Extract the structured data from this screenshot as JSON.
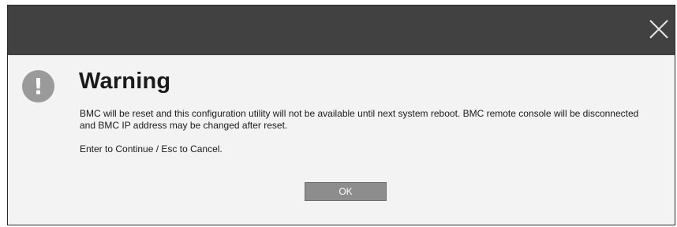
{
  "dialog": {
    "title": "Warning",
    "icon": "warning-exclamation-icon",
    "message": "BMC will be reset and this configuration utility will not be available until next system reboot. BMC remote console will be disconnected and BMC IP address may be changed after reset.",
    "prompt": "Enter to Continue / Esc to Cancel.",
    "ok_label": "OK",
    "close_icon": "close-icon"
  },
  "colors": {
    "titlebar": "#414141",
    "body": "#f3f3f3",
    "button": "#8d8d8d",
    "icon": "#9a9a9a"
  }
}
